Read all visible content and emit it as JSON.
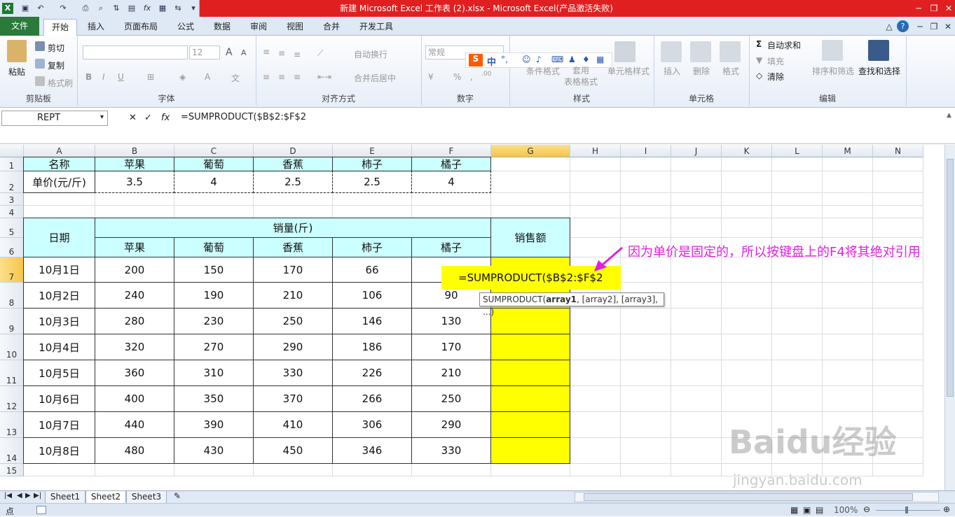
{
  "window": {
    "title": "新建 Microsoft Excel 工作表 (2).xlsx - Microsoft Excel(产品激活失败)"
  },
  "tabs": [
    "文件",
    "开始",
    "插入",
    "页面布局",
    "公式",
    "数据",
    "审阅",
    "视图",
    "合并",
    "开发工具"
  ],
  "ribbon": {
    "clipboard": {
      "label": "剪贴板",
      "paste": "粘贴",
      "cut": "剪切",
      "copy": "复制",
      "format_painter": "格式刷"
    },
    "font": {
      "label": "字体",
      "size": "12"
    },
    "alignment": {
      "label": "对齐方式",
      "wrap": "自动换行",
      "merge": "合并后居中"
    },
    "number": {
      "label": "数字",
      "format": "常规"
    },
    "styles": {
      "label": "样式",
      "conditional": "条件格式",
      "table": "套用\n表格格式",
      "cell_styles": "单元格样式"
    },
    "cells": {
      "label": "单元格",
      "insert": "插入",
      "delete": "删除",
      "format": "格式"
    },
    "editing": {
      "label": "编辑",
      "autosum": "自动求和",
      "fill": "填充",
      "clear": "清除",
      "sort": "排序和筛选",
      "find": "查找和选择"
    }
  },
  "formula_bar": {
    "name_box": "REPT",
    "formula": "=SUMPRODUCT($B$2:$F$2"
  },
  "columns": [
    "A",
    "B",
    "C",
    "D",
    "E",
    "F",
    "G",
    "H",
    "I",
    "J",
    "K",
    "L",
    "M",
    "N"
  ],
  "rows": [
    "1",
    "2",
    "3",
    "4",
    "5",
    "6",
    "7",
    "8",
    "9",
    "10",
    "11",
    "12",
    "13",
    "14",
    "15"
  ],
  "price_table": {
    "header": [
      "名称",
      "苹果",
      "葡萄",
      "香蕉",
      "柿子",
      "橘子"
    ],
    "row": [
      "单价(元/斤)",
      "3.5",
      "4",
      "2.5",
      "2.5",
      "4"
    ]
  },
  "sales_table": {
    "date_header": "日期",
    "qty_header": "销量(斤)",
    "amount_header": "销售额",
    "fruits": [
      "苹果",
      "葡萄",
      "香蕉",
      "柿子",
      "橘子"
    ],
    "rows": [
      [
        "10月1日",
        "200",
        "150",
        "170",
        "66",
        ""
      ],
      [
        "10月2日",
        "240",
        "190",
        "210",
        "106",
        "90"
      ],
      [
        "10月3日",
        "280",
        "230",
        "250",
        "146",
        "130"
      ],
      [
        "10月4日",
        "320",
        "270",
        "290",
        "186",
        "170"
      ],
      [
        "10月5日",
        "360",
        "310",
        "330",
        "226",
        "210"
      ],
      [
        "10月6日",
        "400",
        "350",
        "370",
        "266",
        "250"
      ],
      [
        "10月7日",
        "440",
        "390",
        "410",
        "306",
        "290"
      ],
      [
        "10月8日",
        "480",
        "430",
        "450",
        "346",
        "330"
      ]
    ]
  },
  "editing_cell": "=SUMPRODUCT($B$2:$F$2",
  "tooltip": {
    "func": "SUMPRODUCT(",
    "arg1": "array1",
    "rest": ", [array2], [array3], ...)"
  },
  "annotation": "因为单价是固定的，所以按键盘上的F4将其绝对引用",
  "sheets": [
    "Sheet1",
    "Sheet2",
    "Sheet3"
  ],
  "status": {
    "mode": "点",
    "zoom": "100%"
  },
  "watermark": {
    "brand": "Baidu经验",
    "url": "jingyan.baidu.com"
  },
  "colors": {
    "accent_cyan": "#ccffff",
    "highlight": "#ffff00",
    "annotation": "#e020e0",
    "title": "#e02020"
  }
}
